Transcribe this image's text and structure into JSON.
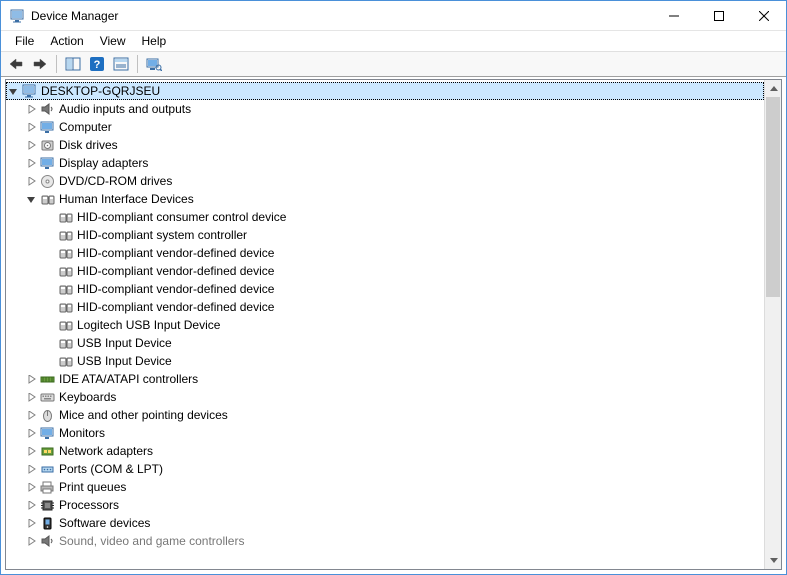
{
  "window": {
    "title": "Device Manager"
  },
  "menu": {
    "file": "File",
    "action": "Action",
    "view": "View",
    "help": "Help"
  },
  "tree": {
    "root": {
      "label": "DESKTOP-GQRJSEU"
    },
    "categories": [
      {
        "label": "Audio inputs and outputs",
        "icon": "speaker",
        "expanded": false
      },
      {
        "label": "Computer",
        "icon": "monitor",
        "expanded": false
      },
      {
        "label": "Disk drives",
        "icon": "disk",
        "expanded": false
      },
      {
        "label": "Display adapters",
        "icon": "monitor",
        "expanded": false
      },
      {
        "label": "DVD/CD-ROM drives",
        "icon": "dvd",
        "expanded": false
      },
      {
        "label": "Human Interface Devices",
        "icon": "hid",
        "expanded": true,
        "children": [
          {
            "label": "HID-compliant consumer control device"
          },
          {
            "label": "HID-compliant system controller"
          },
          {
            "label": "HID-compliant vendor-defined device"
          },
          {
            "label": "HID-compliant vendor-defined device"
          },
          {
            "label": "HID-compliant vendor-defined device"
          },
          {
            "label": "HID-compliant vendor-defined device"
          },
          {
            "label": "Logitech USB Input Device"
          },
          {
            "label": "USB Input Device"
          },
          {
            "label": "USB Input Device"
          }
        ]
      },
      {
        "label": "IDE ATA/ATAPI controllers",
        "icon": "ide",
        "expanded": false
      },
      {
        "label": "Keyboards",
        "icon": "keyboard",
        "expanded": false
      },
      {
        "label": "Mice and other pointing devices",
        "icon": "mouse",
        "expanded": false
      },
      {
        "label": "Monitors",
        "icon": "monitor",
        "expanded": false
      },
      {
        "label": "Network adapters",
        "icon": "network",
        "expanded": false
      },
      {
        "label": "Ports (COM & LPT)",
        "icon": "port",
        "expanded": false
      },
      {
        "label": "Print queues",
        "icon": "printer",
        "expanded": false
      },
      {
        "label": "Processors",
        "icon": "cpu",
        "expanded": false
      },
      {
        "label": "Software devices",
        "icon": "software",
        "expanded": false
      },
      {
        "label": "Sound, video and game controllers",
        "icon": "speaker",
        "expanded": false,
        "cutoff": true
      }
    ]
  }
}
